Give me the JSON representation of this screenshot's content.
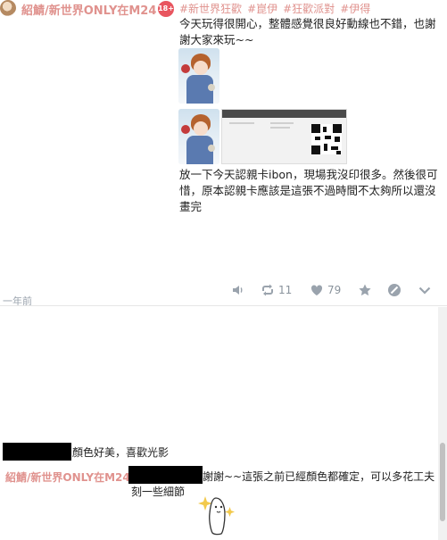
{
  "post": {
    "author": "紹鯖/新世界ONLY在M24",
    "age_badge": "18+",
    "tags": [
      "#新世界狂歡",
      "#崑伊",
      "#狂歡派對",
      "#伊得"
    ],
    "text_1": "今天玩得很開心，整體感覺很良好動線也不錯，也謝謝大家來玩~~",
    "text_2": "放一下今天認親卡ibon，現場我沒印很多。然後很可惜，原本認親卡應該是這張不過時間不太夠所以還沒畫完",
    "ticket_cols": [
      "",
      "",
      ""
    ]
  },
  "actions": {
    "volume_icon": "volume-icon",
    "reblog_count": "11",
    "like_count": "79",
    "star_icon": "star-icon",
    "block_icon": "block-icon",
    "chevron_icon": "chevron-down-icon"
  },
  "timestamp": "一年前",
  "comments": [
    {
      "text": "顏色好美，喜歡光影"
    },
    {
      "author": "紹鯖/新世界ONLY在M24",
      "text": "謝謝~~這張之前已經顏色都確定，可以多花工夫刻一些細節"
    }
  ],
  "colors": {
    "accent": "#e0928e",
    "icon": "#9aa3ad",
    "badge": "#e8555f"
  }
}
